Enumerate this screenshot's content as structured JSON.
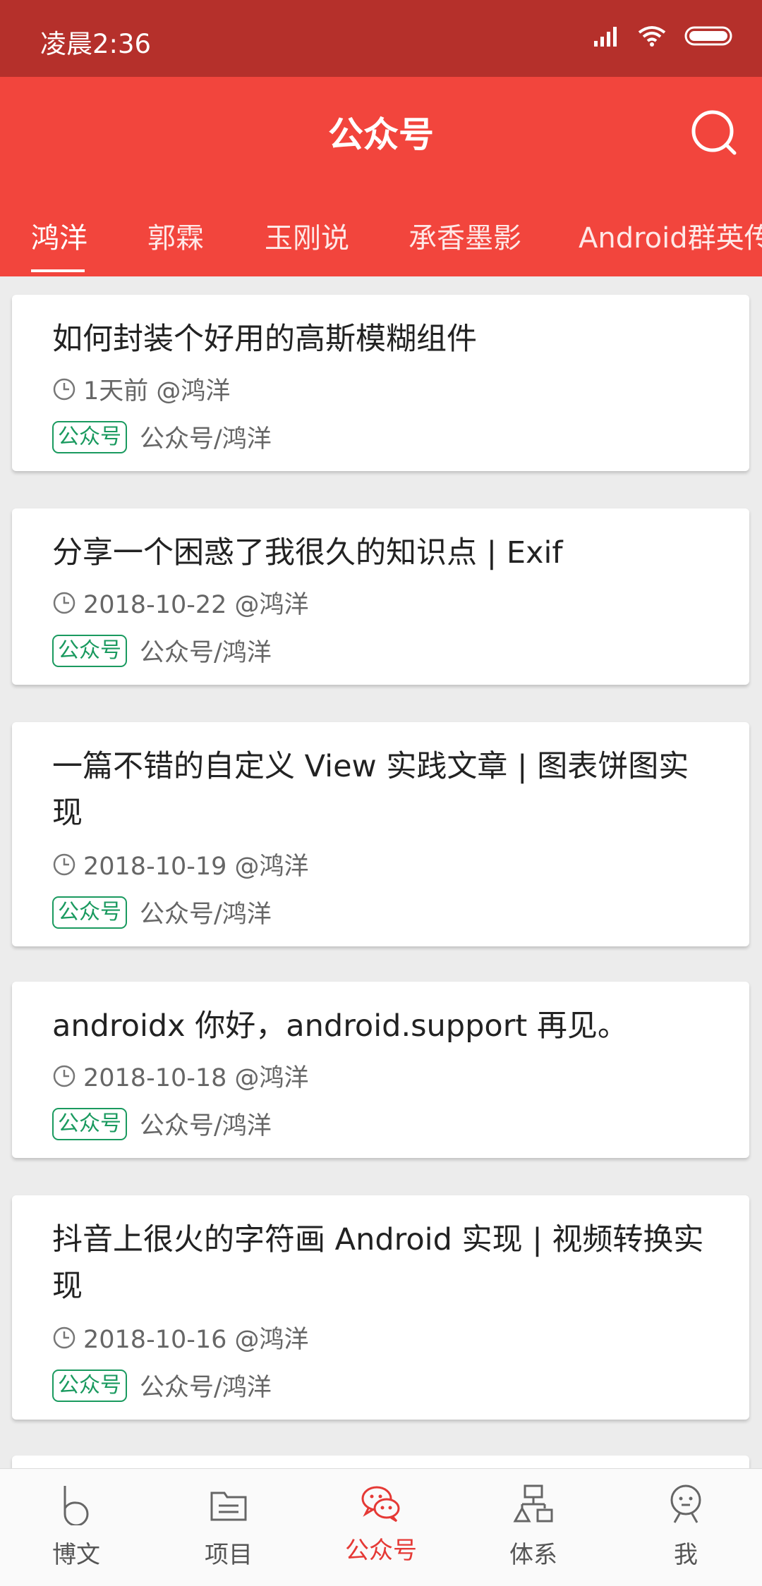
{
  "status": {
    "time": "凌晨2:36"
  },
  "header": {
    "title": "公众号"
  },
  "tabs": [
    {
      "label": "鸿洋"
    },
    {
      "label": "郭霖"
    },
    {
      "label": "玉刚说"
    },
    {
      "label": "承香墨影"
    },
    {
      "label": "Android群英传"
    }
  ],
  "articles": [
    {
      "title": "如何封装个好用的高斯模糊组件",
      "meta": "1天前 @鸿洋",
      "tag": "公众号",
      "category": "公众号/鸿洋"
    },
    {
      "title": "分享一个困惑了我很久的知识点 | Exif",
      "meta": "2018-10-22 @鸿洋",
      "tag": "公众号",
      "category": "公众号/鸿洋"
    },
    {
      "title": "一篇不错的自定义 View 实践文章 | 图表饼图实现",
      "meta": "2018-10-19 @鸿洋",
      "tag": "公众号",
      "category": "公众号/鸿洋"
    },
    {
      "title": "androidx 你好，android.support 再见。",
      "meta": "2018-10-18 @鸿洋",
      "tag": "公众号",
      "category": "公众号/鸿洋"
    },
    {
      "title": "抖音上很火的字符画 Android 实现 | 视频转换实现",
      "meta": "2018-10-16 @鸿洋",
      "tag": "公众号",
      "category": "公众号/鸿洋"
    }
  ],
  "nav": [
    {
      "label": "博文",
      "icon": "blog-icon"
    },
    {
      "label": "项目",
      "icon": "project-icon"
    },
    {
      "label": "公众号",
      "icon": "wechat-icon"
    },
    {
      "label": "体系",
      "icon": "system-icon"
    },
    {
      "label": "我",
      "icon": "profile-icon"
    }
  ],
  "colors": {
    "status_bar": "#b5302b",
    "app_bar": "#f2453d",
    "tag": "#1a9a5f",
    "nav_active": "#e53935"
  }
}
